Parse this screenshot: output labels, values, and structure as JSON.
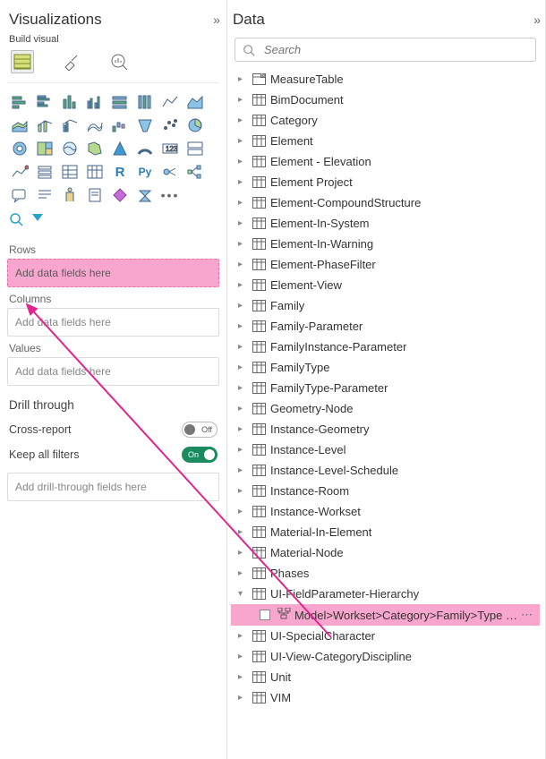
{
  "viz": {
    "title": "Visualizations",
    "sub": "Build visual",
    "modes": [
      {
        "name": "table-mode",
        "selected": true
      },
      {
        "name": "format-mode",
        "selected": false
      },
      {
        "name": "analytics-mode",
        "selected": false
      }
    ],
    "sections": {
      "rows": {
        "label": "Rows",
        "placeholder": "Add data fields here",
        "highlight": true
      },
      "columns": {
        "label": "Columns",
        "placeholder": "Add data fields here",
        "highlight": false
      },
      "values": {
        "label": "Values",
        "placeholder": "Add data fields here",
        "highlight": false
      }
    },
    "drill": {
      "title": "Drill through",
      "cross": {
        "label": "Cross-report",
        "on": false,
        "off_text": "Off"
      },
      "keep": {
        "label": "Keep all filters",
        "on": true,
        "on_text": "On"
      },
      "placeholder": "Add drill-through fields here"
    }
  },
  "data": {
    "title": "Data",
    "search_placeholder": "Search",
    "tables": [
      {
        "label": "MeasureTable",
        "kind": "measure"
      },
      {
        "label": "BimDocument",
        "kind": "table"
      },
      {
        "label": "Category",
        "kind": "table"
      },
      {
        "label": "Element",
        "kind": "table"
      },
      {
        "label": "Element - Elevation",
        "kind": "table"
      },
      {
        "label": "Element Project",
        "kind": "table"
      },
      {
        "label": "Element-CompoundStructure",
        "kind": "table"
      },
      {
        "label": "Element-In-System",
        "kind": "table"
      },
      {
        "label": "Element-In-Warning",
        "kind": "table"
      },
      {
        "label": "Element-PhaseFilter",
        "kind": "table"
      },
      {
        "label": "Element-View",
        "kind": "table"
      },
      {
        "label": "Family",
        "kind": "table"
      },
      {
        "label": "Family-Parameter",
        "kind": "table"
      },
      {
        "label": "FamilyInstance-Parameter",
        "kind": "table"
      },
      {
        "label": "FamilyType",
        "kind": "table"
      },
      {
        "label": "FamilyType-Parameter",
        "kind": "table"
      },
      {
        "label": "Geometry-Node",
        "kind": "table"
      },
      {
        "label": "Instance-Geometry",
        "kind": "table"
      },
      {
        "label": "Instance-Level",
        "kind": "table"
      },
      {
        "label": "Instance-Level-Schedule",
        "kind": "table"
      },
      {
        "label": "Instance-Room",
        "kind": "table"
      },
      {
        "label": "Instance-Workset",
        "kind": "table"
      },
      {
        "label": "Material-In-Element",
        "kind": "table"
      },
      {
        "label": "Material-Node",
        "kind": "table"
      },
      {
        "label": "Phases",
        "kind": "table"
      },
      {
        "label": "UI-FieldParameter-Hierarchy",
        "kind": "table",
        "expanded": true,
        "children": [
          {
            "label": "Model>Workset>Category>Family>Type …",
            "kind": "hierarchy",
            "selected": true
          }
        ]
      },
      {
        "label": "UI-SpecialCharacter",
        "kind": "table"
      },
      {
        "label": "UI-View-CategoryDiscipline",
        "kind": "table"
      },
      {
        "label": "Unit",
        "kind": "table"
      },
      {
        "label": "VIM",
        "kind": "table"
      }
    ]
  },
  "colors": {
    "highlight": "#f9a6cf",
    "accent": "#e0268e",
    "toggle_on": "#1a8a5f"
  }
}
